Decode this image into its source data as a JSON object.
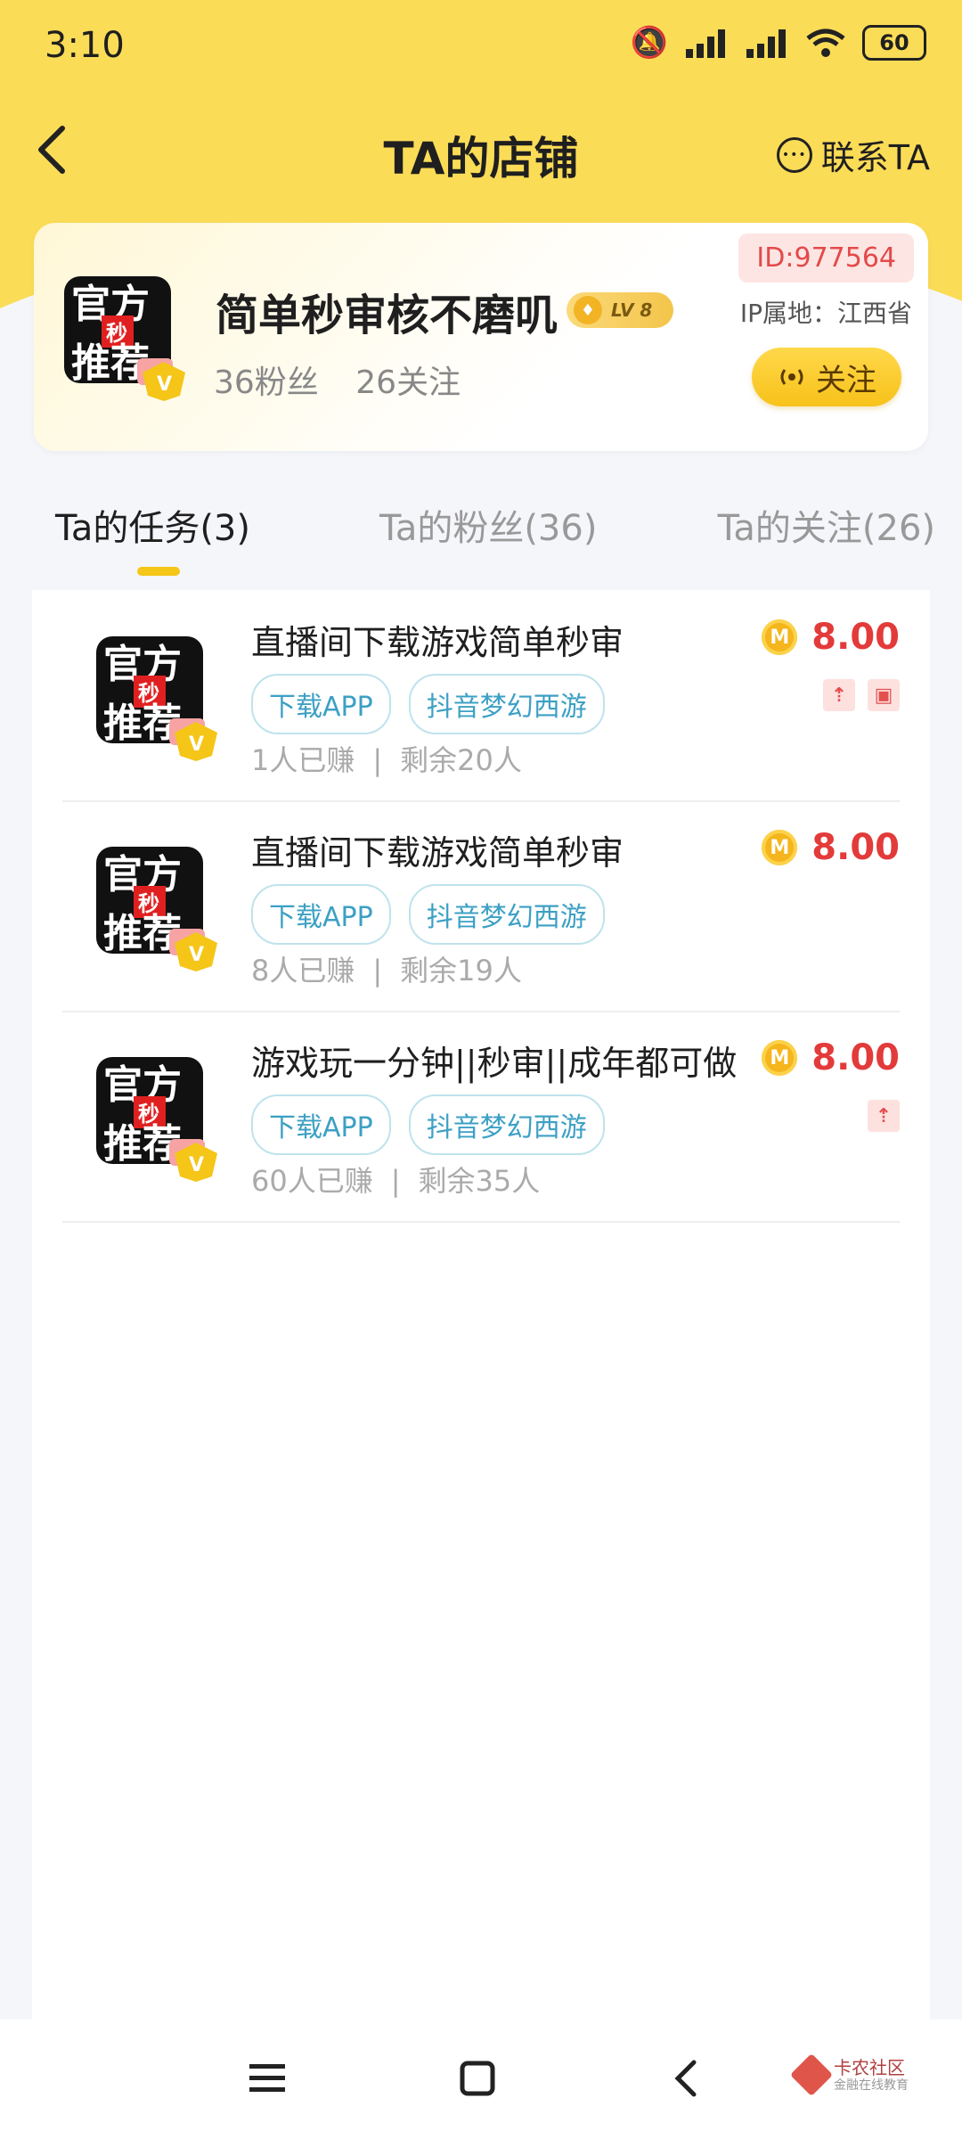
{
  "status_bar": {
    "time": "3:10",
    "battery": "60"
  },
  "header": {
    "title": "TA的店铺",
    "contact_label": "联系TA"
  },
  "shop": {
    "id": "ID:977564",
    "name": "简单秒审核不磨叽",
    "level": "LV 8",
    "ip_location": "IP属地：江西省",
    "fans": "36粉丝",
    "following": "26关注",
    "follow_label": "关注",
    "avatar": {
      "line1": "官方",
      "line2": "推荐",
      "badge": "秒"
    }
  },
  "tabs": [
    {
      "label": "Ta的任务(3)",
      "active": true
    },
    {
      "label": "Ta的粉丝(36)",
      "active": false
    },
    {
      "label": "Ta的关注(26)",
      "active": false
    }
  ],
  "tasks": [
    {
      "title": "直播间下载游戏简单秒审",
      "tags": [
        "下载APP",
        "抖音梦幻西游"
      ],
      "earned": "1人已赚",
      "remaining": "剩余20人",
      "reward": "8.00",
      "flags": [
        "top",
        "red-packet"
      ]
    },
    {
      "title": "直播间下载游戏简单秒审",
      "tags": [
        "下载APP",
        "抖音梦幻西游"
      ],
      "earned": "8人已赚",
      "remaining": "剩余19人",
      "reward": "8.00",
      "flags": []
    },
    {
      "title": "游戏玩一分钟||秒审||成年都可做",
      "tags": [
        "下载APP",
        "抖音梦幻西游"
      ],
      "earned": "60人已赚",
      "remaining": "剩余35人",
      "reward": "8.00",
      "flags": [
        "top"
      ]
    }
  ],
  "meta_separator": "|",
  "coin_symbol": "M",
  "watermark": {
    "line1": "卡农社区",
    "line2": "金融在线教育"
  },
  "colors": {
    "accent_yellow": "#fbdc57",
    "price_red": "#e33a3a",
    "tag_blue": "#3ca0c4",
    "id_red": "#e34a4a"
  }
}
